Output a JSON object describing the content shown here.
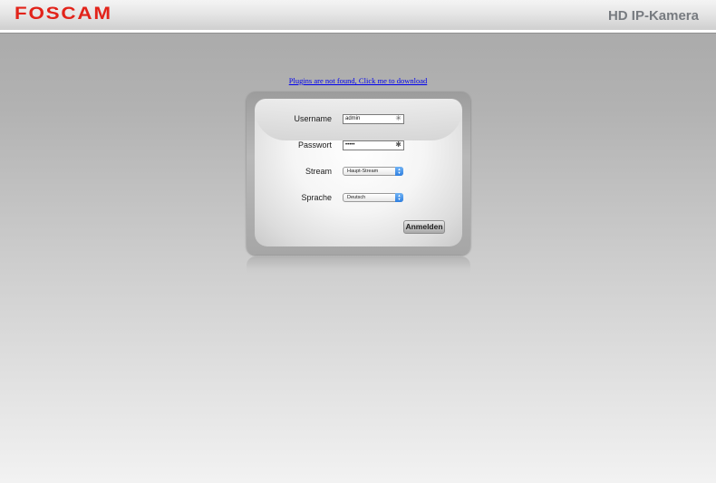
{
  "header": {
    "logo": "FOSCAM",
    "product_title": "HD IP-Kamera"
  },
  "plugin_notice": {
    "link_text": "Plugins are not found, Click me to download"
  },
  "login_form": {
    "username": {
      "label": "Username",
      "value": "admin",
      "icon": "asterisk-icon"
    },
    "password": {
      "label": "Passwort",
      "value": "•••••",
      "icon": "asterisk-icon"
    },
    "stream": {
      "label": "Stream",
      "selected": "Haupt-Stream"
    },
    "language": {
      "label": "Sprache",
      "selected": "Deutsch"
    },
    "submit_label": "Anmelden"
  },
  "colors": {
    "brand_red": "#e2231a",
    "title_grey": "#777b80",
    "link_blue": "#0000ee",
    "select_arrow_blue": "#2f7fe0"
  }
}
